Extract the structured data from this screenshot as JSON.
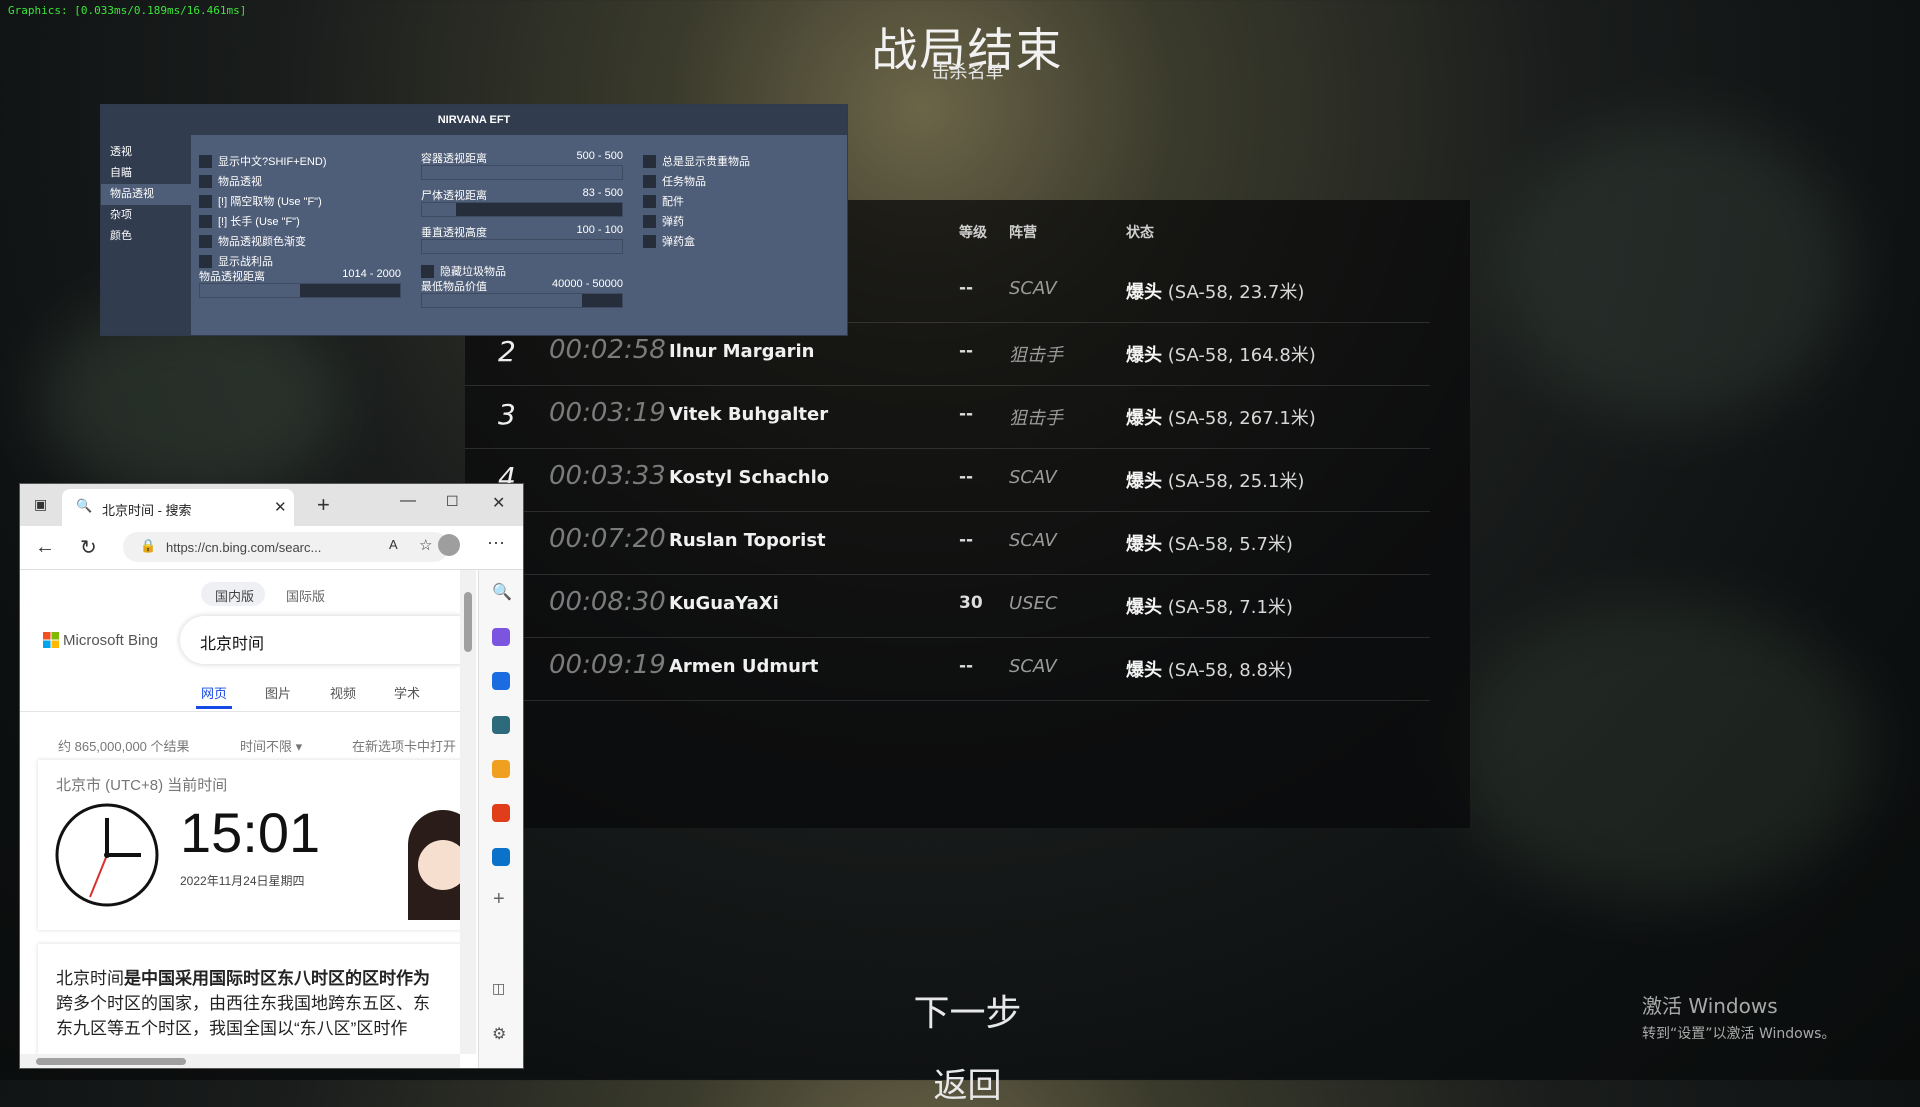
{
  "perf": "Graphics: [0.033ms/0.189ms/16.461ms]",
  "title": "战局结束",
  "subtitle": "击杀名单",
  "table": {
    "headers": {
      "level": "等级",
      "faction": "阵营",
      "status": "状态"
    },
    "rows": [
      {
        "num": "",
        "time": "",
        "name": "",
        "level": "--",
        "faction": "SCAV",
        "status_bold": "爆头",
        "status_rest": " (SA-58, 23.7米)"
      },
      {
        "num": "2",
        "time": "00:02:58",
        "name": "Ilnur Margarin",
        "level": "--",
        "faction": "狙击手",
        "status_bold": "爆头",
        "status_rest": " (SA-58, 164.8米)"
      },
      {
        "num": "3",
        "time": "00:03:19",
        "name": "Vitek Buhgalter",
        "level": "--",
        "faction": "狙击手",
        "status_bold": "爆头",
        "status_rest": " (SA-58, 267.1米)"
      },
      {
        "num": "4",
        "time": "00:03:33",
        "name": "Kostyl Schachlo",
        "level": "--",
        "faction": "SCAV",
        "status_bold": "爆头",
        "status_rest": " (SA-58, 25.1米)"
      },
      {
        "num": "",
        "time": "00:07:20",
        "name": "Ruslan Toporist",
        "level": "--",
        "faction": "SCAV",
        "status_bold": "爆头",
        "status_rest": " (SA-58, 5.7米)"
      },
      {
        "num": "",
        "time": "00:08:30",
        "name": "KuGuaYaXi",
        "level": "30",
        "faction": "USEC",
        "status_bold": "爆头",
        "status_rest": " (SA-58, 7.1米)"
      },
      {
        "num": "",
        "time": "00:09:19",
        "name": "Armen Udmurt",
        "level": "--",
        "faction": "SCAV",
        "status_bold": "爆头",
        "status_rest": " (SA-58, 8.8米)"
      }
    ]
  },
  "next_label": "下一步",
  "back_label": "返回",
  "activate": {
    "line1": "激活 Windows",
    "line2": "转到“设置”以激活 Windows。"
  },
  "menu": {
    "title": "NIRVANA EFT",
    "sidebar": [
      "透视",
      "自瞄",
      "物品透视",
      "杂项",
      "颜色"
    ],
    "col1_checks": [
      "显示中文?SHIF+END)",
      "物品透视",
      "[!] 隔空取物 (Use \"F\")",
      "[!] 长手 (Use \"F\")",
      "物品透视颜色渐变",
      "显示战利品"
    ],
    "col1_slider": {
      "label": "物品透视距离",
      "value": "1014 - 2000",
      "fill": 0.5
    },
    "col2_sliders": [
      {
        "label": "容器透视距离",
        "value": "500 - 500",
        "fill": 1.0
      },
      {
        "label": "尸体透视距离",
        "value": "83 - 500",
        "fill": 0.17
      },
      {
        "label": "垂直透视高度",
        "value": "100 - 100",
        "fill": 1.0
      }
    ],
    "col2_check": "隐藏垃圾物品",
    "col2_slider": {
      "label": "最低物品价值",
      "value": "40000 - 50000",
      "fill": 0.8
    },
    "col3_checks": [
      "总是显示贵重物品",
      "任务物品",
      "配件",
      "弹药",
      "弹药盒"
    ]
  },
  "browser": {
    "tab_title": "北京时间 - 搜索",
    "url": "https://cn.bing.com/searc...",
    "region_tabs": [
      "国内版",
      "国际版"
    ],
    "brand": "Microsoft Bing",
    "query": "北京时间",
    "nav_tabs": [
      "网页",
      "图片",
      "视频",
      "学术"
    ],
    "result_count": "约 865,000,000 个结果",
    "time_filter": "时间不限",
    "open_new_tab": "在新选项卡中打开",
    "clock_heading": "北京市 (UTC+8) 当前时间",
    "clock_time": "15:01",
    "clock_date": "2022年11月24日星期四",
    "snippet_1a": "北京时间",
    "snippet_1b": "是中国采用国际时区东八时区的区时作为",
    "snippet_2": "跨多个时区的国家，由西往东我国地跨东五区、东",
    "snippet_3": "东九区等五个时区，我国全国以“东八区”区时作"
  }
}
